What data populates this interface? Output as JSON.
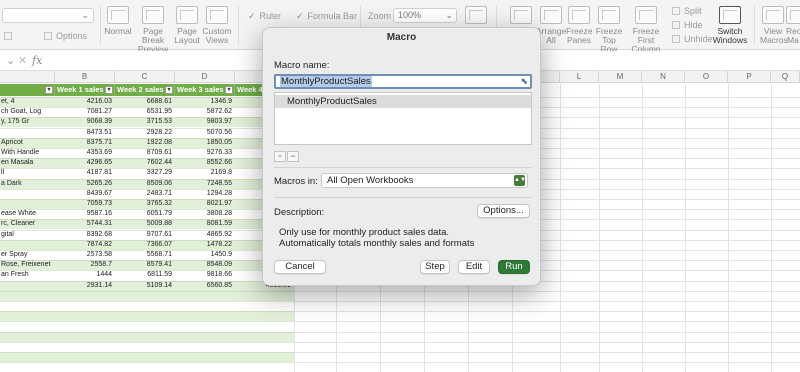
{
  "ribbon": {
    "group_view": [
      "Normal",
      "Page Break Preview",
      "Page Layout",
      "Custom Views"
    ],
    "options_label": "Options",
    "show": {
      "ruler": "Ruler",
      "formula_bar": "Formula Bar"
    },
    "zoom": {
      "label": "Zoom",
      "value": "100%"
    },
    "window": [
      "Arrange All",
      "Freeze Panes",
      "Freeze Top Row",
      "Freeze First Column"
    ],
    "split": "Split",
    "hide": "Hide",
    "unhide": "Unhide",
    "switch_windows": "Switch Windows",
    "view_macros": "View Macros",
    "record_macro": "Rec Ma"
  },
  "formula_bar": {
    "fx": "fx"
  },
  "sheet": {
    "columns": [
      "B",
      "C",
      "D",
      "L",
      "M",
      "N",
      "O",
      "P",
      "Q"
    ],
    "headers": [
      "Week 1 sales",
      "Week 2 sales",
      "Week 3 sales",
      "Week 4"
    ],
    "rows": [
      [
        "et, 4",
        "4216.03",
        "6688.61",
        "1346.9"
      ],
      [
        "ch Goat, Log",
        "7081.27",
        "6531.95",
        "5872.62"
      ],
      [
        "y, 175 Gr",
        "9068.39",
        "3715.53",
        "9803.97"
      ],
      [
        "",
        "8473.51",
        "2928.22",
        "5070.56"
      ],
      [
        "Apricot",
        "8375.71",
        "1922.08",
        "1850.05"
      ],
      [
        "With Handle",
        "4353.69",
        "8709.61",
        "9276.33"
      ],
      [
        "en Masala",
        "4296.65",
        "7602.44",
        "8552.66"
      ],
      [
        "ll",
        "4187.81",
        "3327.29",
        "2169.8"
      ],
      [
        "a Dark",
        "5265.26",
        "8509.06",
        "7248.55"
      ],
      [
        "",
        "8439.67",
        "2483.71",
        "1294.28"
      ],
      [
        "",
        "7059.73",
        "3765.32",
        "8021.97"
      ],
      [
        "ease White",
        "9587.16",
        "6051.79",
        "3808.28"
      ],
      [
        "rc, Cleaner",
        "5744.31",
        "5009.88",
        "8081.59"
      ],
      [
        "gital",
        "8392.68",
        "9707.61",
        "4865.92"
      ],
      [
        "",
        "7874.82",
        "7366.07",
        "1478.22"
      ],
      [
        "er Spray",
        "2573.58",
        "5568.71",
        "1450.9"
      ],
      [
        "Rose, Freixenet",
        "2558.7",
        "8579.41",
        "8548.09"
      ],
      [
        "an Fresh",
        "1444",
        "6811.59",
        "9818.66"
      ],
      [
        "",
        "2931.14",
        "5109.14",
        "6560.85"
      ]
    ],
    "last_total": "4803.09"
  },
  "dialog": {
    "title": "Macro",
    "macro_name_label": "Macro name:",
    "macro_name_value": "MonthlyProductSales",
    "macro_list": [
      "MonthlyProductSales"
    ],
    "macros_in_label": "Macros in:",
    "macros_in_value": "All Open Workbooks",
    "description_label": "Description:",
    "options_button": "Options...",
    "description_lines": [
      "Only use for monthly product sales data.",
      "Automatically totals monthly sales and formats"
    ],
    "buttons": {
      "cancel": "Cancel",
      "step": "Step",
      "edit": "Edit",
      "run": "Run"
    }
  },
  "colors": {
    "accent_green": "#70ad47",
    "run_button": "#2f7a35",
    "row_band": "#e2efd9"
  }
}
